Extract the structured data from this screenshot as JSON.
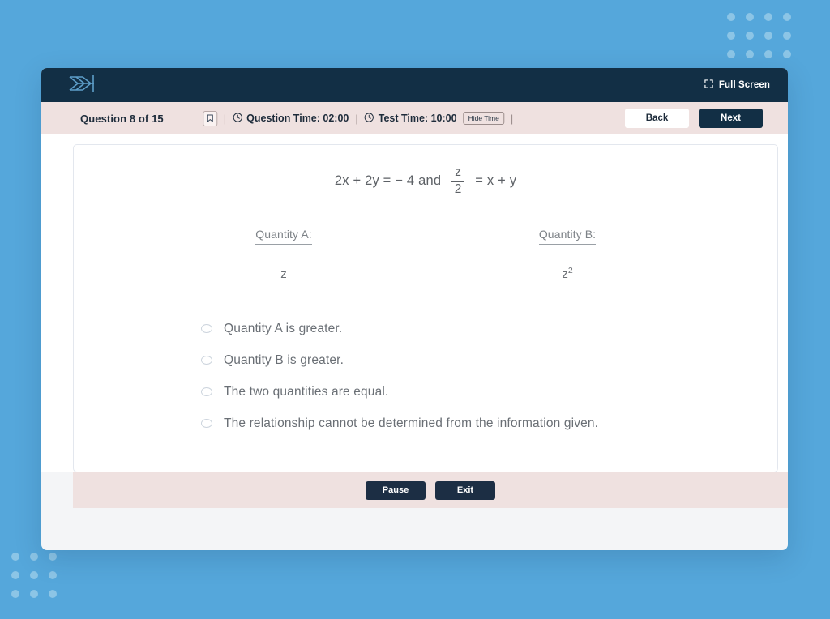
{
  "background": {
    "color": "#55a7db",
    "dot_color": "#8cc5e6",
    "top_right_dots": {
      "cols": 4,
      "rows": 3
    },
    "bottom_left_dots": {
      "cols": 3,
      "rows": 3
    }
  },
  "appbar": {
    "logo_name": "arrow-fletching-logo",
    "fullscreen_label": "Full Screen",
    "fullscreen_icon": "fullscreen-expand-icon",
    "background": "#122f45"
  },
  "toolbar": {
    "question_counter": "Question 8 of 15",
    "bookmark_icon": "bookmark-icon",
    "separator": "|",
    "clock_icon": "clock-icon",
    "question_time_label": "Question Time: 02:00",
    "test_time_label": "Test Time: 10:00",
    "hide_time_label": "Hide Time",
    "back_label": "Back",
    "next_label": "Next",
    "background": "#efe1e0"
  },
  "question": {
    "equation": {
      "left": "2x + 2y = − 4 and",
      "fraction_numerator": "z",
      "fraction_denominator": "2",
      "right": "= x + y",
      "full_text": "2x + 2y = − 4 and z/2 = x + y"
    },
    "quantity_a": {
      "label": "Quantity A:",
      "value": "z",
      "exponent": ""
    },
    "quantity_b": {
      "label": "Quantity B:",
      "value": "z",
      "exponent": "2"
    },
    "options": [
      {
        "id": "a",
        "label": "Quantity A is greater.",
        "selected": false
      },
      {
        "id": "b",
        "label": "Quantity B is greater.",
        "selected": false
      },
      {
        "id": "c",
        "label": "The two quantities are equal.",
        "selected": false
      },
      {
        "id": "d",
        "label": "The relationship cannot be determined from the information given.",
        "selected": false
      }
    ]
  },
  "footer": {
    "pause_label": "Pause",
    "exit_label": "Exit"
  }
}
